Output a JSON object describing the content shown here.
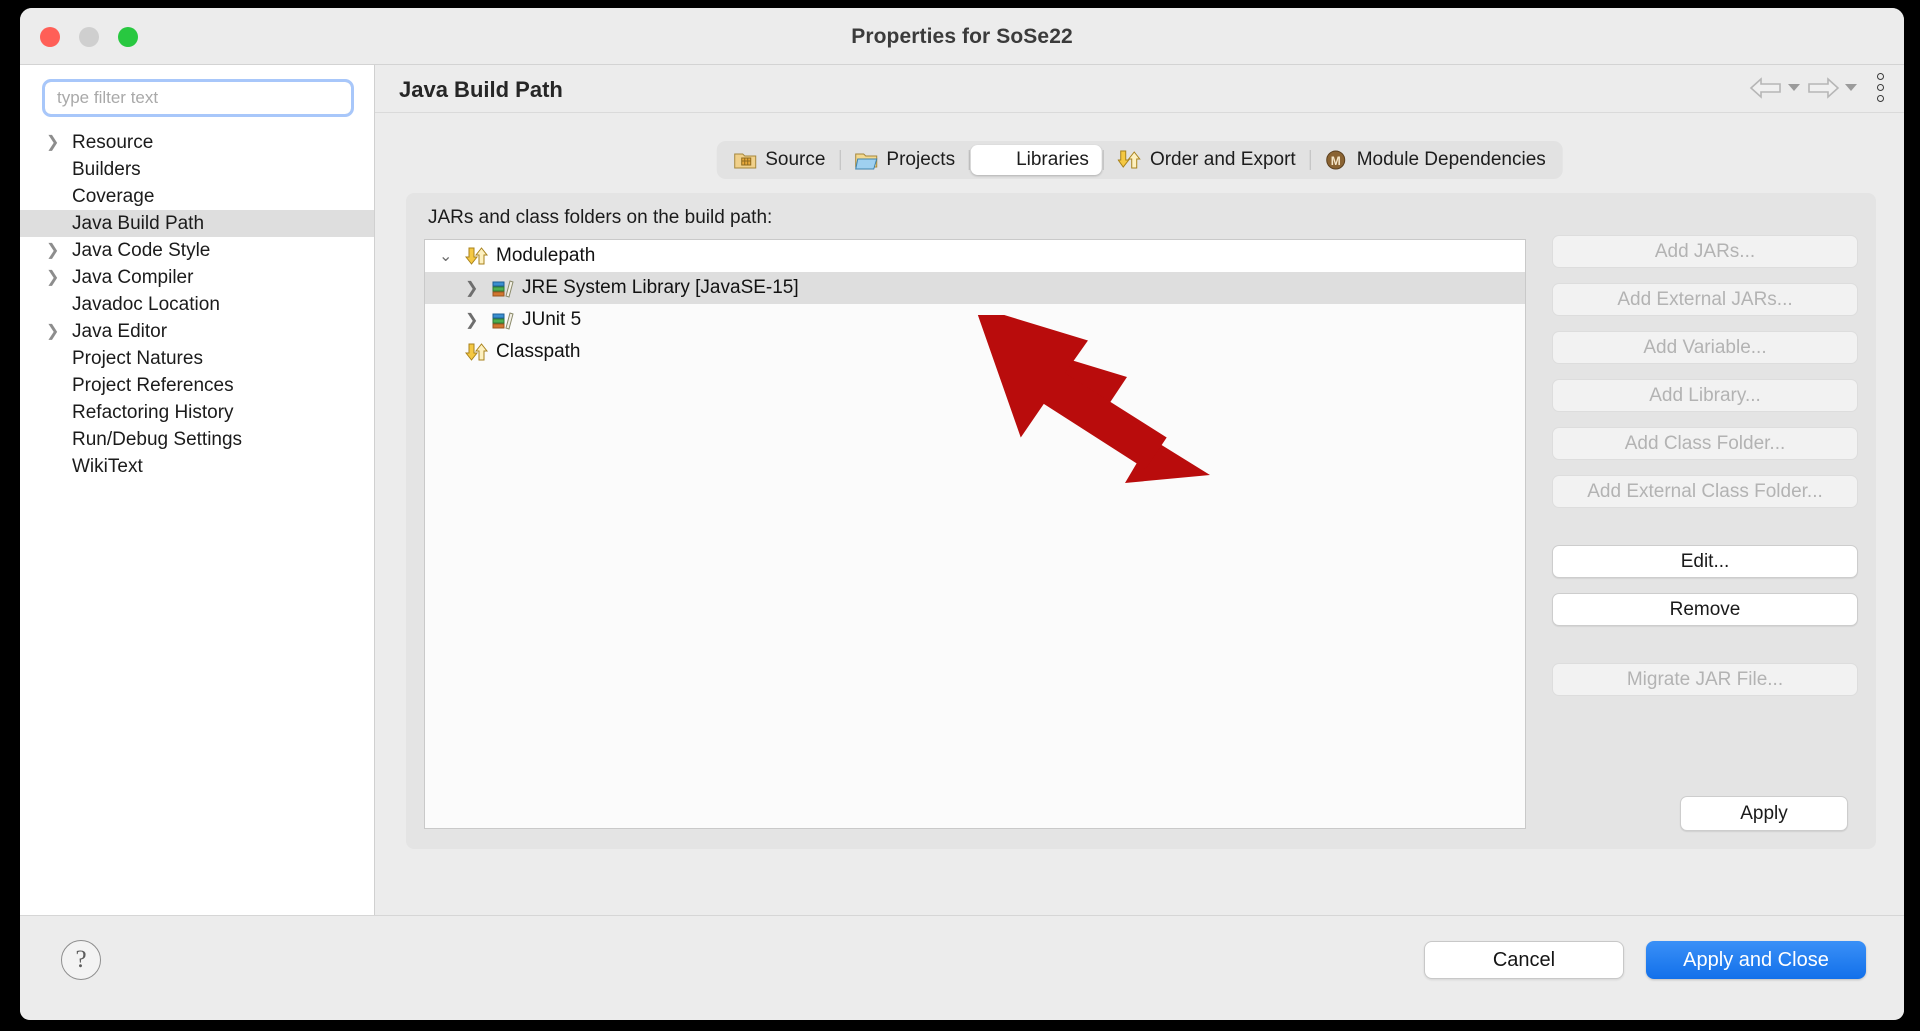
{
  "window": {
    "title": "Properties for SoSe22",
    "traffic_lights": [
      "close",
      "minimize",
      "zoom"
    ]
  },
  "sidebar": {
    "filter": {
      "placeholder": "type filter text",
      "value": ""
    },
    "items": [
      {
        "label": "Resource",
        "expandable": true,
        "selected": false
      },
      {
        "label": "Builders",
        "expandable": false,
        "selected": false
      },
      {
        "label": "Coverage",
        "expandable": false,
        "selected": false
      },
      {
        "label": "Java Build Path",
        "expandable": false,
        "selected": true
      },
      {
        "label": "Java Code Style",
        "expandable": true,
        "selected": false
      },
      {
        "label": "Java Compiler",
        "expandable": true,
        "selected": false
      },
      {
        "label": "Javadoc Location",
        "expandable": false,
        "selected": false
      },
      {
        "label": "Java Editor",
        "expandable": true,
        "selected": false
      },
      {
        "label": "Project Natures",
        "expandable": false,
        "selected": false
      },
      {
        "label": "Project References",
        "expandable": false,
        "selected": false
      },
      {
        "label": "Refactoring History",
        "expandable": false,
        "selected": false
      },
      {
        "label": "Run/Debug Settings",
        "expandable": false,
        "selected": false
      },
      {
        "label": "WikiText",
        "expandable": false,
        "selected": false
      }
    ]
  },
  "page": {
    "title": "Java Build Path",
    "nav": {
      "back_icon": "back-arrow-icon",
      "forward_icon": "forward-arrow-icon",
      "menu_icon": "kebab-menu-icon"
    }
  },
  "tabs": [
    {
      "label": "Source",
      "icon": "source-folder-icon",
      "active": false
    },
    {
      "label": "Projects",
      "icon": "projects-folder-icon",
      "active": false
    },
    {
      "label": "Libraries",
      "icon": "libraries-books-icon",
      "active": true
    },
    {
      "label": "Order and Export",
      "icon": "order-export-arrows-icon",
      "active": false
    },
    {
      "label": "Module Dependencies",
      "icon": "module-badge-icon",
      "active": false
    }
  ],
  "content": {
    "label": "JARs and class folders on the build path:",
    "tree": [
      {
        "label": "Modulepath",
        "icon": "modulepath-arrows-icon",
        "level": 0,
        "twisty": "expanded",
        "selected": false,
        "stripe": "alt"
      },
      {
        "label": "JRE System Library [JavaSE-15]",
        "icon": "library-books-icon",
        "level": 1,
        "twisty": "collapsed",
        "selected": true,
        "stripe": "sel"
      },
      {
        "label": "JUnit 5",
        "icon": "library-books-icon",
        "level": 1,
        "twisty": "collapsed",
        "selected": false,
        "stripe": "plain"
      },
      {
        "label": "Classpath",
        "icon": "classpath-arrows-icon",
        "level": 0,
        "twisty": "none",
        "selected": false,
        "stripe": "plain"
      }
    ]
  },
  "buttons": [
    {
      "label": "Add JARs...",
      "enabled": false
    },
    {
      "label": "Add External JARs...",
      "enabled": false
    },
    {
      "label": "Add Variable...",
      "enabled": false
    },
    {
      "label": "Add Library...",
      "enabled": false
    },
    {
      "label": "Add Class Folder...",
      "enabled": false
    },
    {
      "label": "Add External Class Folder...",
      "enabled": false
    },
    {
      "label": "Edit...",
      "enabled": true
    },
    {
      "label": "Remove",
      "enabled": true
    },
    {
      "label": "Migrate JAR File...",
      "enabled": false
    }
  ],
  "apply": {
    "label": "Apply"
  },
  "footer": {
    "help_icon": "help-question-icon",
    "help_glyph": "?",
    "cancel_label": "Cancel",
    "apply_close_label": "Apply and Close"
  },
  "annotation": {
    "type": "red-arrow",
    "color": "#b90c0c",
    "points_to": "JUnit 5"
  },
  "colors": {
    "accent": "#1270ea",
    "selection": "#dedede",
    "window_bg": "#ececec",
    "annotation": "#b90c0c"
  }
}
